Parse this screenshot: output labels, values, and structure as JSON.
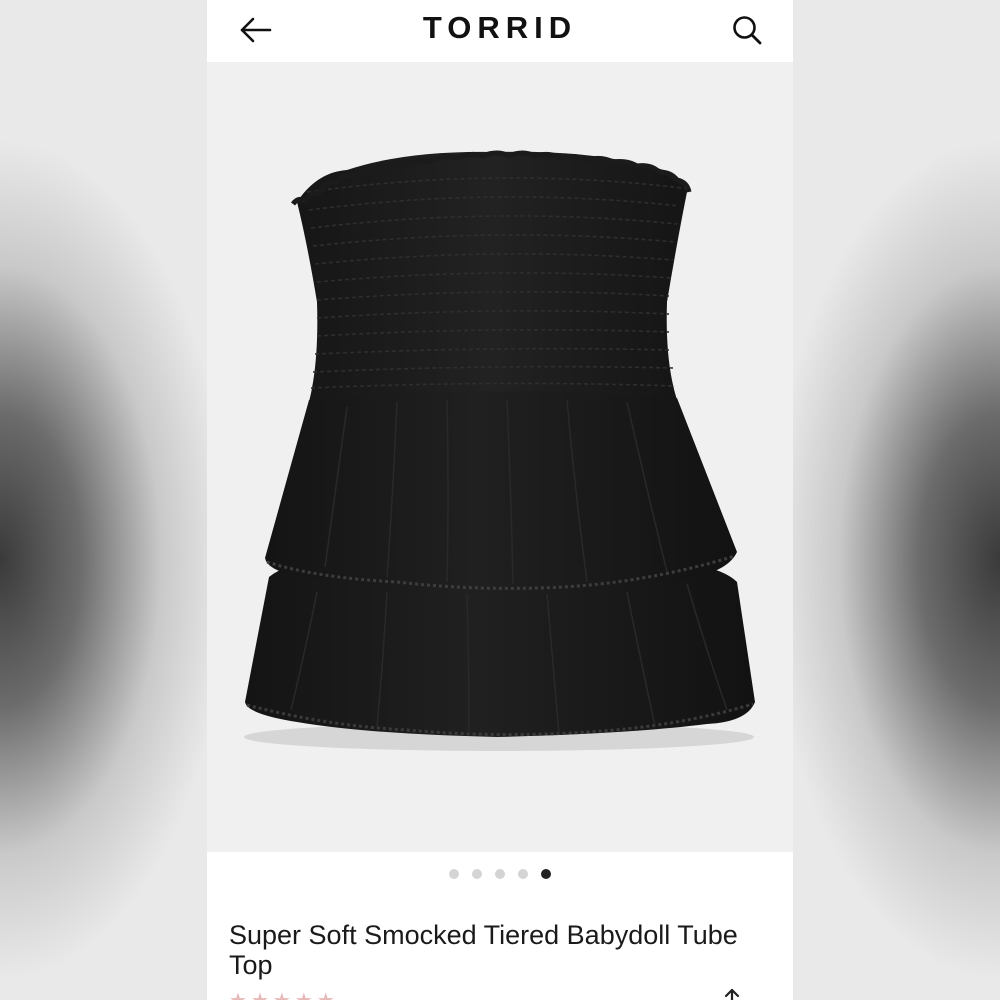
{
  "header": {
    "brand": "TORRID",
    "back_icon": "arrow-left-icon",
    "search_icon": "search-icon"
  },
  "gallery": {
    "image_count": 5,
    "active_index": 4,
    "image_alt": "black strapless smocked tiered babydoll tube top"
  },
  "product": {
    "title": "Super Soft Smocked Tiered Babydoll Tube Top",
    "rating_stars": 5,
    "review_count": "",
    "share_icon": "share-icon"
  },
  "colors": {
    "text": "#1a1a1a",
    "dot_active": "#222222",
    "dot_inactive": "#d4d4d4",
    "gallery_bg": "#f0f0f0",
    "star": "#e7b9b9"
  }
}
